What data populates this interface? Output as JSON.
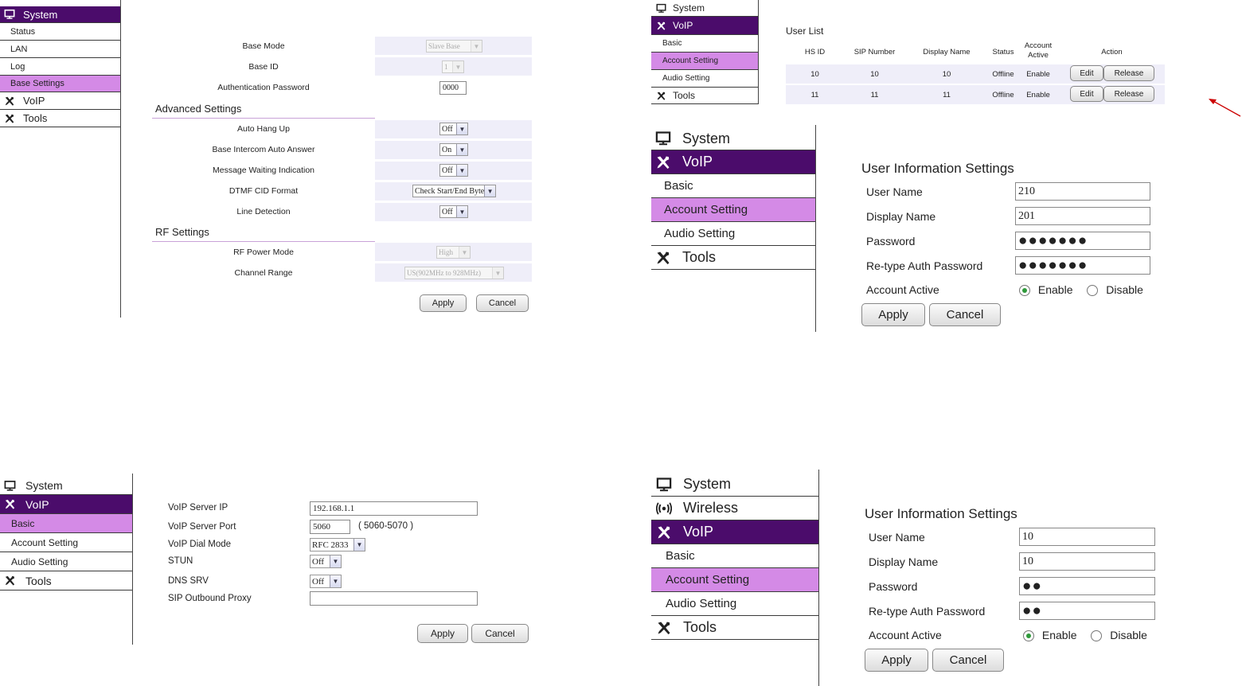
{
  "icons": {
    "system": "monitor-icon",
    "voip": "tools-cross-icon",
    "tools": "tools-cross-icon",
    "wireless": "wireless-icon"
  },
  "colors": {
    "nav_dark": "#4b0c6b",
    "nav_highlight": "#d48ae6",
    "row_bg": "#efeef9",
    "radio_on": "#2f9a3b",
    "arrow": "#cc0000"
  },
  "panel1": {
    "nav": {
      "system": "System",
      "status": "Status",
      "lan": "LAN",
      "log": "Log",
      "base_settings": "Base Settings",
      "voip": "VoIP",
      "tools": "Tools"
    },
    "rows": {
      "base_mode": {
        "label": "Base Mode",
        "value": "Slave Base"
      },
      "base_id": {
        "label": "Base ID",
        "value": "1"
      },
      "auth_password": {
        "label": "Authentication Password",
        "value": "0000"
      }
    },
    "advanced_title": "Advanced Settings",
    "advanced": {
      "auto_hang_up": {
        "label": "Auto Hang Up",
        "value": "Off"
      },
      "intercom": {
        "label": "Base Intercom Auto Answer",
        "value": "On"
      },
      "mwi": {
        "label": "Message Waiting Indication",
        "value": "Off"
      },
      "dtmf": {
        "label": "DTMF CID Format",
        "value": "Check Start/End Byte"
      },
      "line_detection": {
        "label": "Line Detection",
        "value": "Off"
      }
    },
    "rf_title": "RF Settings",
    "rf": {
      "power_mode": {
        "label": "RF Power Mode",
        "value": "High"
      },
      "channel_range": {
        "label": "Channel Range",
        "value": "US(902MHz to 928MHz)"
      }
    },
    "apply": "Apply",
    "cancel": "Cancel"
  },
  "panel2": {
    "nav": {
      "system": "System",
      "voip": "VoIP",
      "basic": "Basic",
      "account": "Account Setting",
      "audio": "Audio Setting",
      "tools": "Tools"
    },
    "title": "User List",
    "headers": {
      "hs_id": "HS ID",
      "sip": "SIP Number",
      "display": "Display Name",
      "status": "Status",
      "active": "Account Active",
      "action": "Action"
    },
    "rows": [
      {
        "hs_id": "10",
        "sip": "10",
        "display": "10",
        "status": "Offline",
        "active": "Enable",
        "edit": "Edit",
        "release": "Release"
      },
      {
        "hs_id": "11",
        "sip": "11",
        "display": "11",
        "status": "Offline",
        "active": "Enable",
        "edit": "Edit",
        "release": "Release"
      }
    ]
  },
  "panel3": {
    "nav": {
      "system": "System",
      "voip": "VoIP",
      "basic": "Basic",
      "account": "Account Setting",
      "audio": "Audio Setting",
      "tools": "Tools"
    },
    "title": "User Information Settings",
    "user_name": {
      "label": "User Name",
      "value": "210"
    },
    "display_name": {
      "label": "Display Name",
      "value": "201"
    },
    "password": {
      "label": "Password",
      "value": "●●●●●●●"
    },
    "retype": {
      "label": "Re-type Auth Password",
      "value": "●●●●●●●"
    },
    "active": {
      "label": "Account Active",
      "enable": "Enable",
      "disable": "Disable"
    },
    "apply": "Apply",
    "cancel": "Cancel"
  },
  "panel4": {
    "nav": {
      "system": "System",
      "voip": "VoIP",
      "basic": "Basic",
      "account": "Account Setting",
      "audio": "Audio Setting",
      "tools": "Tools"
    },
    "server_ip": {
      "label": "VoIP Server IP",
      "value": "192.168.1.1"
    },
    "server_port": {
      "label": "VoIP Server Port",
      "value": "5060",
      "hint": "( 5060-5070 )"
    },
    "dial_mode": {
      "label": "VoIP Dial Mode",
      "value": "RFC 2833"
    },
    "stun": {
      "label": "STUN",
      "value": "Off"
    },
    "dns_srv": {
      "label": "DNS SRV",
      "value": "Off"
    },
    "outbound": {
      "label": "SIP Outbound Proxy",
      "value": ""
    },
    "apply": "Apply",
    "cancel": "Cancel"
  },
  "panel5": {
    "nav": {
      "system": "System",
      "wireless": "Wireless",
      "voip": "VoIP",
      "basic": "Basic",
      "account": "Account Setting",
      "audio": "Audio Setting",
      "tools": "Tools"
    },
    "title": "User Information Settings",
    "user_name": {
      "label": "User Name",
      "value": "10"
    },
    "display_name": {
      "label": "Display Name",
      "value": "10"
    },
    "password": {
      "label": "Password",
      "value": "●●"
    },
    "retype": {
      "label": "Re-type Auth Password",
      "value": "●●"
    },
    "active": {
      "label": "Account Active",
      "enable": "Enable",
      "disable": "Disable"
    },
    "apply": "Apply",
    "cancel": "Cancel"
  }
}
